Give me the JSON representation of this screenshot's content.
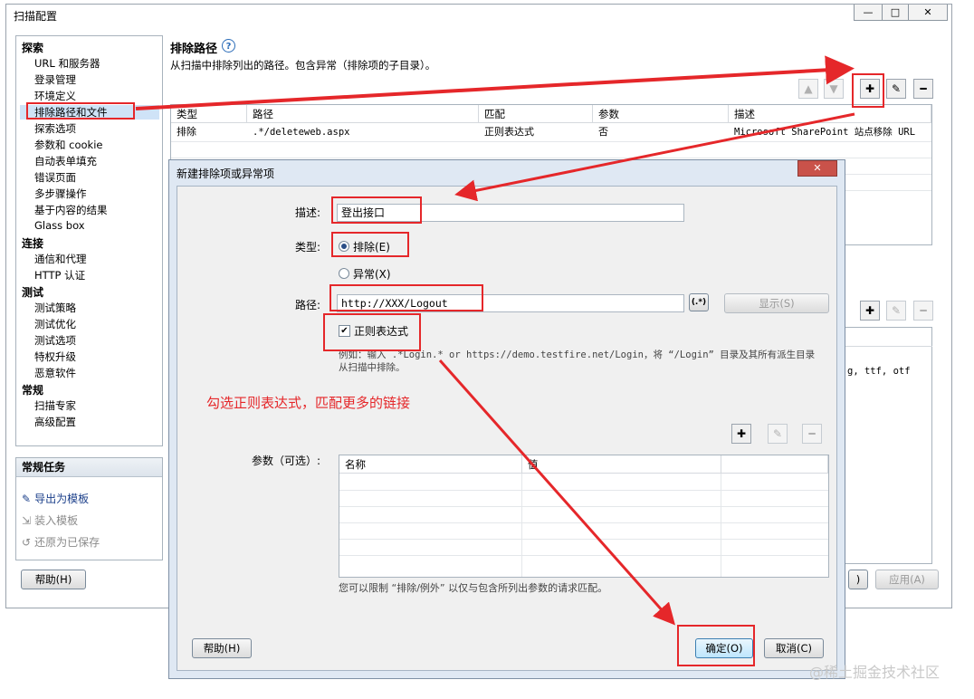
{
  "window": {
    "title": "扫描配置",
    "controls": [
      "—",
      "□",
      "✕"
    ]
  },
  "sidebar": {
    "categories": [
      {
        "label": "探索",
        "items": [
          "URL 和服务器",
          "登录管理",
          "环境定义",
          "排除路径和文件",
          "探索选项",
          "参数和 cookie",
          "自动表单填充",
          "错误页面",
          "多步骤操作",
          "基于内容的结果",
          "Glass box"
        ]
      },
      {
        "label": "连接",
        "items": [
          "通信和代理",
          "HTTP 认证"
        ]
      },
      {
        "label": "测试",
        "items": [
          "测试策略",
          "测试优化",
          "测试选项",
          "特权升级",
          "恶意软件"
        ]
      },
      {
        "label": "常规",
        "items": [
          "扫描专家",
          "高级配置"
        ]
      }
    ],
    "selected": "排除路径和文件"
  },
  "tasks": {
    "title": "常规任务",
    "items": [
      {
        "label": "导出为模板",
        "enabled": true,
        "icon": "export-icon"
      },
      {
        "label": "装入模板",
        "enabled": false,
        "icon": "load-icon"
      },
      {
        "label": "还原为已保存",
        "enabled": false,
        "icon": "restore-icon"
      }
    ]
  },
  "main": {
    "heading": "排除路径",
    "help_glyph": "?",
    "description": "从扫描中排除列出的路径。包含异常（排除项的子目录）。",
    "table": {
      "headers": [
        "类型",
        "路径",
        "匹配",
        "参数",
        "描述"
      ],
      "rows": [
        [
          "排除",
          ".*/deleteweb.aspx",
          "正则表达式",
          "否",
          "Microsoft SharePoint 站点移除 URL"
        ]
      ]
    },
    "second_list_fragment": "g, ttf, otf"
  },
  "footer": {
    "help_button": "帮助(H)",
    "ok_fragment": ")",
    "apply_button": "应用(A)"
  },
  "dialog": {
    "title": "新建排除项或异常项",
    "close_glyph": "✕",
    "description_label": "描述:",
    "description_value": "登出接口",
    "type_label": "类型:",
    "radio_exclude": "排除(E)",
    "radio_exception": "异常(X)",
    "path_label": "路径:",
    "path_value": "http://XXX/Logout",
    "regex_button": "(.*)",
    "show_button": "显示(S)",
    "regex_checkbox": "正则表达式",
    "example_line1": "例如：输入 .*Login.* or https://demo.testfire.net/Login，将 “/Login” 目录及其所有派生目录",
    "example_line2": "从扫描中排除。",
    "params_label": "参数（可选）:",
    "params_headers": [
      "名称",
      "值"
    ],
    "params_note": "您可以限制 “排除/例外” 以仅与包含所列出参数的请求匹配。",
    "help_button": "帮助(H)",
    "ok_button": "确定(O)",
    "cancel_button": "取消(C)"
  },
  "annotation": {
    "text": "勾选正则表达式，匹配更多的链接",
    "color": "#e5272a"
  },
  "watermark": "@稀土掘金技术社区"
}
